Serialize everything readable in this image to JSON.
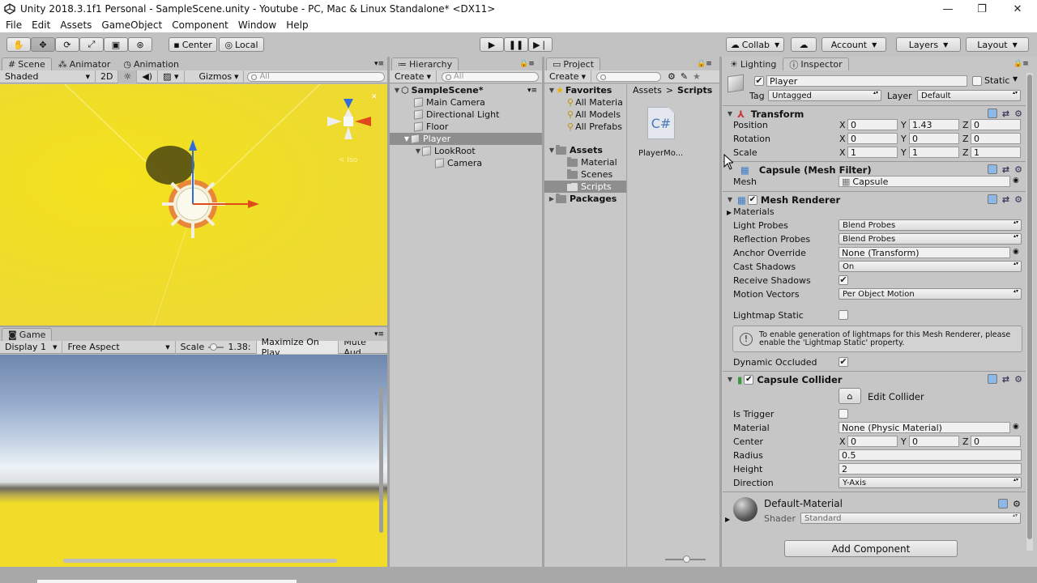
{
  "window": {
    "title": "Unity 2018.3.1f1 Personal - SampleScene.unity - Youtube - PC, Mac & Linux Standalone* <DX11>"
  },
  "menu": [
    "File",
    "Edit",
    "Assets",
    "GameObject",
    "Component",
    "Window",
    "Help"
  ],
  "toolbar": {
    "pivot": "Center",
    "space": "Local",
    "collab": "Collab",
    "account": "Account",
    "layers": "Layers",
    "layout": "Layout"
  },
  "scene": {
    "tabs": [
      "Scene",
      "Animator",
      "Animation"
    ],
    "shading": "Shaded",
    "mode2d": "2D",
    "gizmos": "Gizmos",
    "search_placeholder": "All"
  },
  "game": {
    "tab": "Game",
    "display": "Display 1",
    "aspect": "Free Aspect",
    "scale_label": "Scale",
    "scale_value": "1.38:",
    "maximize": "Maximize On Play",
    "mute": "Mute Aud"
  },
  "hierarchy": {
    "tab": "Hierarchy",
    "create": "Create",
    "search_placeholder": "All",
    "scene": "SampleScene*",
    "items": [
      "Main Camera",
      "Directional Light",
      "Floor",
      "Player",
      "LookRoot",
      "Camera"
    ]
  },
  "project": {
    "tab": "Project",
    "create": "Create",
    "favorites": "Favorites",
    "fav_items": [
      "All Materia",
      "All Models",
      "All Prefabs"
    ],
    "assets": "Assets",
    "asset_folders": [
      "Material",
      "Scenes",
      "Scripts"
    ],
    "packages": "Packages",
    "breadcrumb": [
      "Assets",
      "Scripts"
    ],
    "file_icon": "C#",
    "file_name": "PlayerMo..."
  },
  "inspector": {
    "tabs": [
      "Lighting",
      "Inspector"
    ],
    "object_name": "Player",
    "static_label": "Static",
    "tag_label": "Tag",
    "tag_value": "Untagged",
    "layer_label": "Layer",
    "layer_value": "Default",
    "transform": {
      "title": "Transform",
      "rows": [
        {
          "label": "Position",
          "x": "0",
          "y": "1.43",
          "z": "0"
        },
        {
          "label": "Rotation",
          "x": "0",
          "y": "0",
          "z": "0"
        },
        {
          "label": "Scale",
          "x": "1",
          "y": "1",
          "z": "1"
        }
      ],
      "axes": [
        "X",
        "Y",
        "Z"
      ]
    },
    "mesh_filter": {
      "title": "Capsule (Mesh Filter)",
      "mesh_label": "Mesh",
      "mesh_value": "Capsule"
    },
    "mesh_renderer": {
      "title": "Mesh Renderer",
      "materials": "Materials",
      "light_probes_label": "Light Probes",
      "light_probes": "Blend Probes",
      "reflection_probes_label": "Reflection Probes",
      "reflection_probes": "Blend Probes",
      "anchor_label": "Anchor Override",
      "anchor": "None (Transform)",
      "cast_label": "Cast Shadows",
      "cast": "On",
      "receive_label": "Receive Shadows",
      "motion_label": "Motion Vectors",
      "motion": "Per Object Motion",
      "lightmap_label": "Lightmap Static",
      "info": "To enable generation of lightmaps for this Mesh Renderer, please enable the 'Lightmap Static' property.",
      "occluded_label": "Dynamic Occluded"
    },
    "capsule_collider": {
      "title": "Capsule Collider",
      "edit": "Edit Collider",
      "trigger_label": "Is Trigger",
      "material_label": "Material",
      "material": "None (Physic Material)",
      "center_label": "Center",
      "cx": "0",
      "cy": "0",
      "cz": "0",
      "radius_label": "Radius",
      "radius": "0.5",
      "height_label": "Height",
      "height": "2",
      "direction_label": "Direction",
      "direction": "Y-Axis"
    },
    "material": {
      "name": "Default-Material",
      "shader_label": "Shader",
      "shader": "Standard"
    },
    "add_component": "Add Component"
  },
  "colors": {
    "scene_bg": "#f0dc28",
    "game_sky": "#6b86b0",
    "game_floor": "#f2dc2a",
    "selection": "#8e8e8e",
    "panel": "#c2c2c2"
  }
}
